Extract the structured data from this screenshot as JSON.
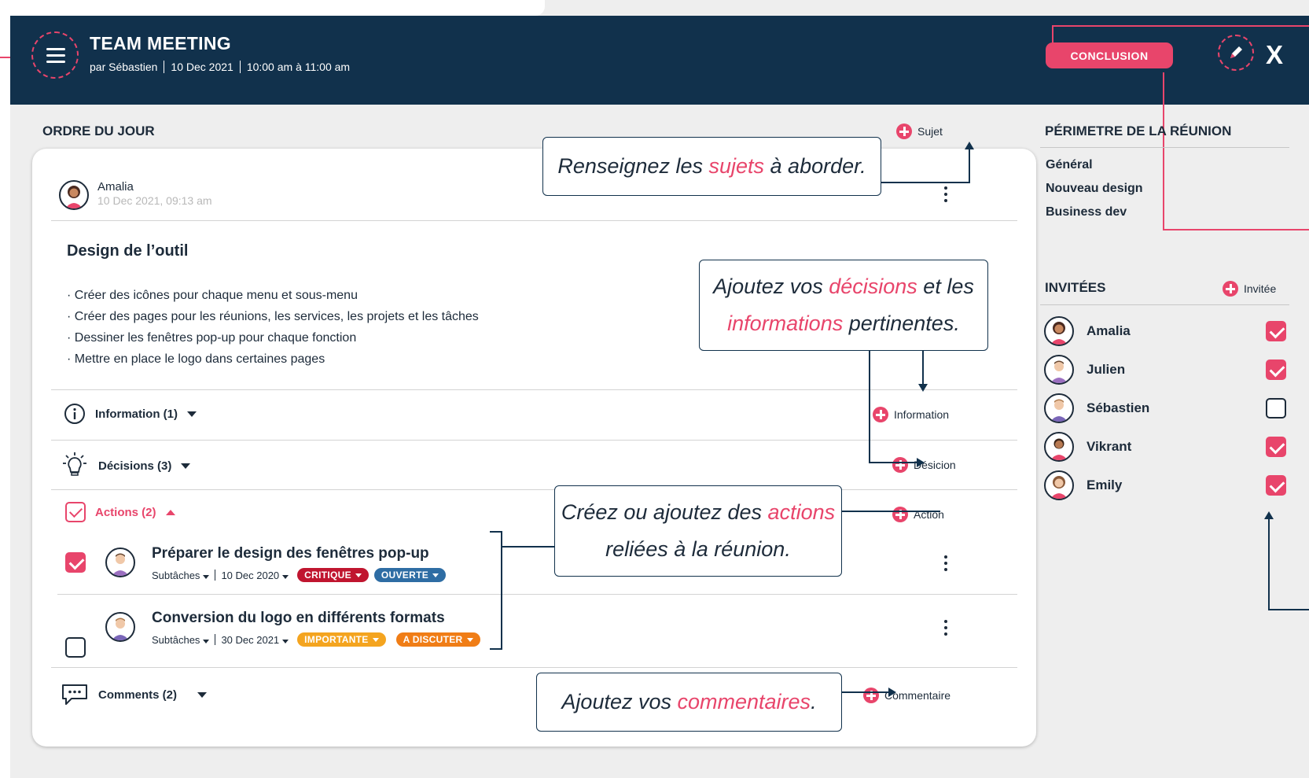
{
  "header": {
    "title": "TEAM MEETING",
    "author": "par Sébastien",
    "date": "10 Dec 2021",
    "time": "10:00 am à 11:00 am",
    "conclusion_label": "CONCLUSION",
    "close_label": "X"
  },
  "agenda": {
    "section_title": "ORDRE DU JOUR",
    "add_subject_label": "Sujet",
    "post_author": "Amalia",
    "post_time": "10 Dec 2021, 09:13 am",
    "topic_title": "Design de l’outil",
    "bullets": [
      "· Créer des icônes pour chaque menu et sous-menu",
      "· Créer des pages pour les réunions, les services, les projets et les tâches",
      "· Dessiner les fenêtres pop-up pour chaque fonction",
      "· Mettre en place le logo dans certaines pages"
    ],
    "information": {
      "label": "Information (1)",
      "add_label": "Information"
    },
    "decisions": {
      "label": "Décisions (3)",
      "add_label": "Désicion"
    },
    "actions": {
      "label": "Actions (2)",
      "add_label": "Action",
      "items": [
        {
          "title": "Préparer le design des fenêtres pop-up",
          "subtasks": "Subtâches",
          "date": "10 Dec 2020",
          "tags": [
            {
              "label": "CRITIQUE",
              "color": "#c0152f"
            },
            {
              "label": "OUVERTE",
              "color": "#2e6da4"
            }
          ],
          "checked": true
        },
        {
          "title": "Conversion du logo en différents formats",
          "subtasks": "Subtâches",
          "date": "30 Dec 2021",
          "tags": [
            {
              "label": "IMPORTANTE",
              "color": "#f4a41f"
            },
            {
              "label": "A DISCUTER",
              "color": "#f07d16"
            }
          ],
          "checked": false
        }
      ]
    },
    "comments": {
      "label": "Comments (2)",
      "add_label": "Commentaire"
    }
  },
  "callouts": {
    "subjects": {
      "pre": "Renseignez les ",
      "hl": "sujets",
      "post": " à aborder."
    },
    "decisions": {
      "pre": "Ajoutez vos ",
      "hl": "décisions",
      "mid": " et les",
      "hl2": "informations",
      "post": " pertinentes."
    },
    "actions": {
      "pre": "Créez ou ajoutez des ",
      "hl": "actions",
      "line2": "reliées à la réunion."
    },
    "comments": {
      "pre": "Ajoutez vos ",
      "hl": "commentaires",
      "post": "."
    }
  },
  "sidebar": {
    "scope_title": "PÉRIMETRE DE LA RÉUNION",
    "scope_items": [
      "Général",
      "Nouveau design",
      "Business dev"
    ],
    "guests_title": "INVITÉES",
    "add_guest_label": "Invitée",
    "guests": [
      {
        "name": "Amalia",
        "checked": true
      },
      {
        "name": "Julien",
        "checked": true
      },
      {
        "name": "Sébastien",
        "checked": false
      },
      {
        "name": "Vikrant",
        "checked": true
      },
      {
        "name": "Emily",
        "checked": true
      }
    ]
  },
  "colors": {
    "navy": "#11314c",
    "accent": "#e8456b",
    "background": "#eeeeee"
  }
}
